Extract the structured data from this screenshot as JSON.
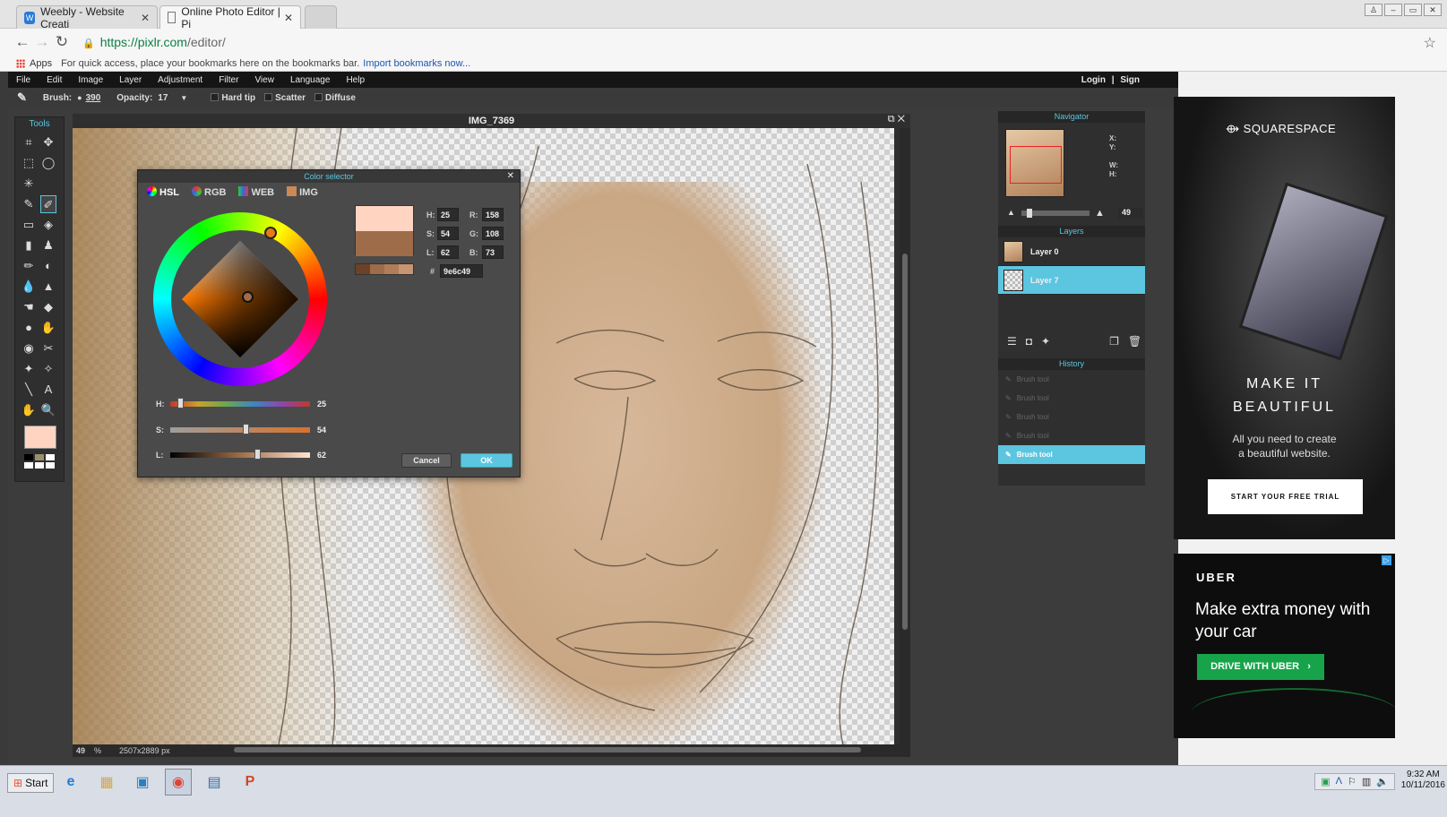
{
  "browser": {
    "tabs": [
      {
        "title": "Weebly - Website Creati",
        "icon": "weebly-icon",
        "active": false
      },
      {
        "title": "Online Photo Editor | Pi",
        "icon": "page-icon",
        "active": true
      }
    ],
    "url_host": "https://pixlr.com",
    "url_path": "/editor/",
    "bookmarks_apps": "Apps",
    "bookmarks_hint": "For quick access, place your bookmarks here on the bookmarks bar.",
    "bookmarks_link": "Import bookmarks now..."
  },
  "menu": {
    "items": [
      "File",
      "Edit",
      "Image",
      "Layer",
      "Adjustment",
      "Filter",
      "View",
      "Language",
      "Help"
    ],
    "login": "Login",
    "sep": "|",
    "signup": "Sign"
  },
  "tool_options": {
    "brush_label": "Brush:",
    "brush_size": "390",
    "opacity_label": "Opacity:",
    "opacity_value": "17",
    "hard_tip": "Hard tip",
    "scatter": "Scatter",
    "diffuse": "Diffuse"
  },
  "tools": {
    "title": "Tools",
    "icons": [
      "crop-icon",
      "move-icon",
      "marquee-icon",
      "lasso-icon",
      "wand-icon",
      "blank",
      "pencil-icon",
      "brush-icon",
      "eraser-icon",
      "bucket-icon",
      "gradient-icon",
      "stamp-icon",
      "picker-icon",
      "replace-icon",
      "drop-icon",
      "sharpen-icon",
      "smudge-icon",
      "sponge-icon",
      "burn-icon",
      "dodge-icon",
      "redeye-icon",
      "spotheal-icon",
      "bloat-icon",
      "pinch-icon",
      "line-icon",
      "text-icon",
      "hand-icon",
      "zoom-icon"
    ],
    "glyphs": [
      "⌗",
      "✥",
      "⬚",
      "◯",
      "✳",
      "",
      "✎",
      "✐",
      "▭",
      "◈",
      "▮",
      "♟",
      "✏",
      "◐",
      "💧",
      "▲",
      "☚",
      "◆",
      "●",
      "✋",
      "◉",
      "✂",
      "✦",
      "✧",
      "╲",
      "A",
      "✋",
      "🔍"
    ],
    "fg_color": "#ffd5c2",
    "swatch_colors": [
      "#000000",
      "#9c8f6e",
      "#ffffff",
      "#ffffff",
      "#ffffff",
      "#ffffff"
    ]
  },
  "canvas": {
    "title": "IMG_7369",
    "zoom": "49",
    "zoom_unit": "%",
    "size": "2507x2889 px"
  },
  "color_selector": {
    "title": "Color selector",
    "tabs": [
      "HSL",
      "RGB",
      "WEB",
      "IMG"
    ],
    "h": "25",
    "s": "54",
    "l": "62",
    "r": "158",
    "g": "108",
    "b": "73",
    "hex_label": "#",
    "hex": "9e6c49",
    "h_label": "H:",
    "s_label": "S:",
    "l_label": "L:",
    "r_label": "R:",
    "g_label": "G:",
    "b_label": "B:",
    "h_fraction": 0.07,
    "s_fraction": 0.54,
    "l_fraction": 0.62,
    "new_color": "#ffd5c2",
    "old_color": "#9e6c49",
    "recent_colors": [
      "#6b4225",
      "#9e6c49",
      "#b07d58",
      "#c79571"
    ],
    "cancel": "Cancel",
    "ok": "OK"
  },
  "navigator": {
    "title": "Navigator",
    "x_label": "X:",
    "y_label": "Y:",
    "w_label": "W:",
    "h_label": "H:",
    "zoom": "49"
  },
  "layers": {
    "title": "Layers",
    "items": [
      {
        "name": "Layer 0",
        "selected": false
      },
      {
        "name": "Layer 7",
        "selected": true
      }
    ]
  },
  "history": {
    "title": "History",
    "items": [
      {
        "name": "Brush tool",
        "selected": false
      },
      {
        "name": "Brush tool",
        "selected": false
      },
      {
        "name": "Brush tool",
        "selected": false
      },
      {
        "name": "Brush tool",
        "selected": false
      },
      {
        "name": "Brush tool",
        "selected": true
      }
    ]
  },
  "ads": {
    "squarespace_brand": "SQUARESPACE",
    "squarespace_line1": "MAKE IT",
    "squarespace_line2": "BEAUTIFUL",
    "squarespace_sub1": "All you need to create",
    "squarespace_sub2": "a beautiful website.",
    "squarespace_cta": "START YOUR FREE TRIAL",
    "uber_brand": "UBER",
    "uber_head": "Make extra money with your car",
    "uber_cta": "DRIVE WITH UBER",
    "uber_cta_arrow": "›"
  },
  "taskbar": {
    "start": "Start",
    "time": "9:32 AM",
    "date": "10/11/2016"
  }
}
